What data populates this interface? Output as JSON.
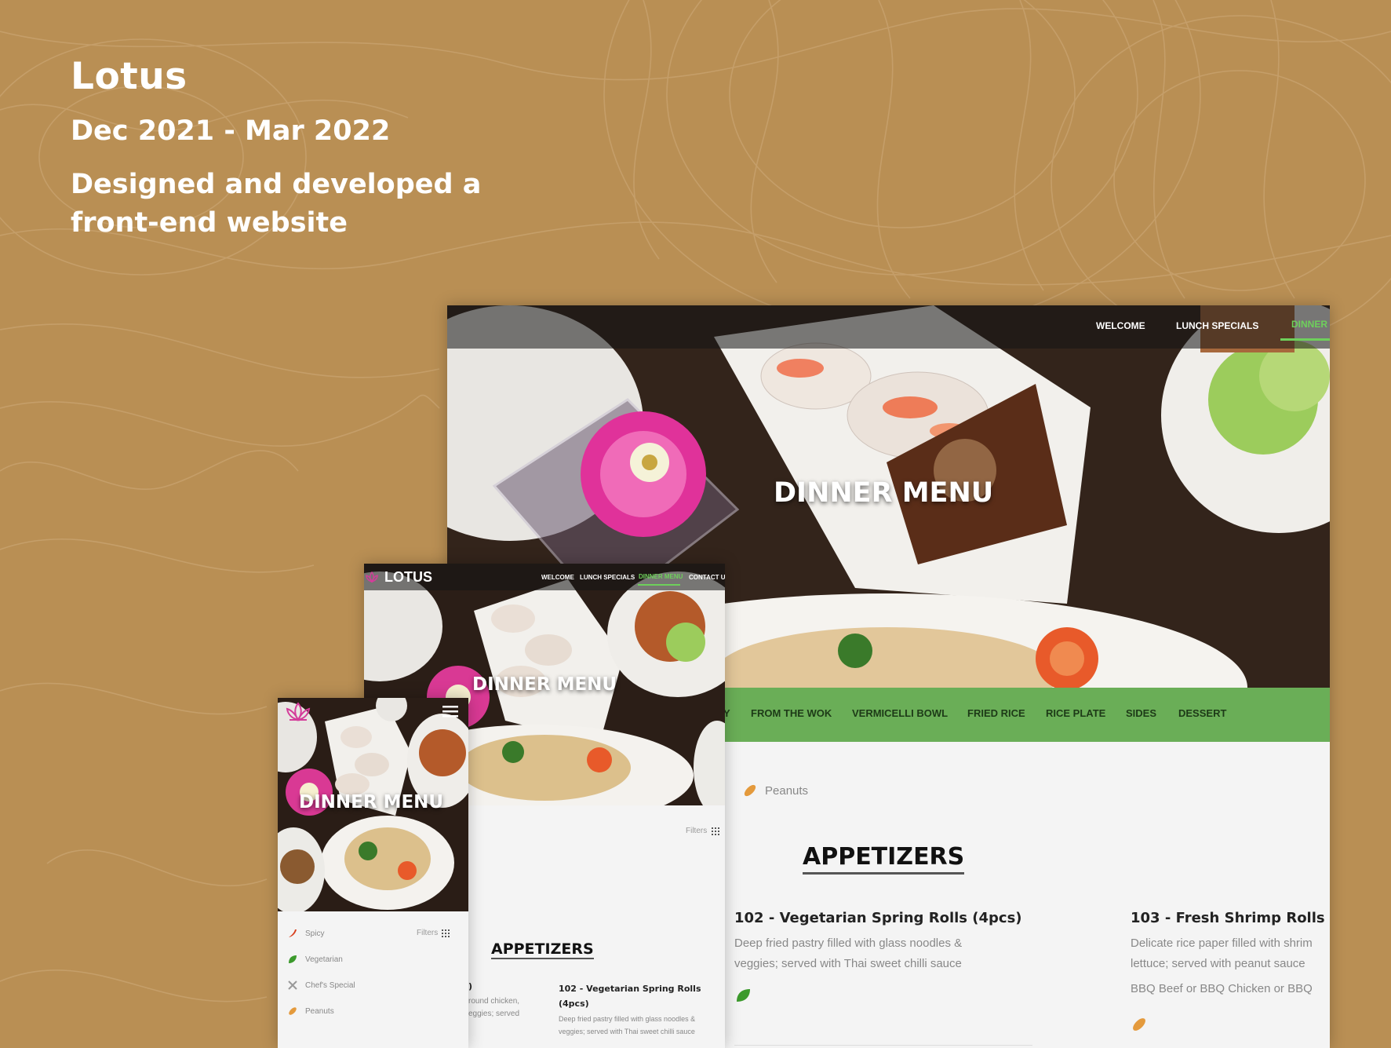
{
  "project": {
    "title": "Lotus",
    "dates": "Dec 2021 - Mar 2022",
    "description": "Designed and developed a front-end website"
  },
  "colors": {
    "background": "#b98f54",
    "nav_active": "#6ed05b",
    "category_bar": "#6aae57",
    "content_bg": "#f4f4f4"
  },
  "desktop": {
    "nav": [
      "WELCOME",
      "LUNCH SPECIALS",
      "DINNER"
    ],
    "hero_title": "DINNER MENU",
    "categories": [
      "Y",
      "FROM THE WOK",
      "VERMICELLI BOWL",
      "FRIED RICE",
      "RICE PLATE",
      "SIDES",
      "DESSERT"
    ],
    "legend_peanuts": "Peanuts",
    "section_title": "APPETIZERS",
    "items": [
      {
        "name": "102 - Vegetarian Spring Rolls (4pcs)",
        "desc": "Deep fried pastry filled with glass noodles & veggies; served with Thai sweet chilli sauce",
        "icon": "leaf-icon"
      },
      {
        "name": "103 - Fresh Shrimp Rolls (2",
        "desc": "Delicate rice paper filled with shrim lettuce; served with peanut sauce",
        "extra": "BBQ Beef or BBQ Chicken or BBQ",
        "icon": "peanut-icon"
      }
    ]
  },
  "tablet": {
    "brand": "LOTUS",
    "nav": [
      "WELCOME",
      "LUNCH SPECIALS",
      "DINNER MENU",
      "CONTACT US"
    ],
    "hero_title": "DINNER MENU",
    "filters": "Filters",
    "section_title": "APPETIZERS",
    "partial_item": {
      "name": ")",
      "desc": "round chicken, eggies; served"
    },
    "item": {
      "name": "102 - Vegetarian Spring Rolls (4pcs)",
      "desc": "Deep fried pastry filled with glass noodles & veggies; served with Thai sweet chilli sauce"
    }
  },
  "mobile": {
    "hero_title": "DINNER MENU",
    "filters": "Filters",
    "legend": [
      {
        "label": "Spicy",
        "icon": "chili-icon"
      },
      {
        "label": "Vegetarian",
        "icon": "leaf-icon"
      },
      {
        "label": "Chef's Special",
        "icon": "crossed-utensils-icon"
      },
      {
        "label": "Peanuts",
        "icon": "peanut-icon"
      }
    ]
  }
}
